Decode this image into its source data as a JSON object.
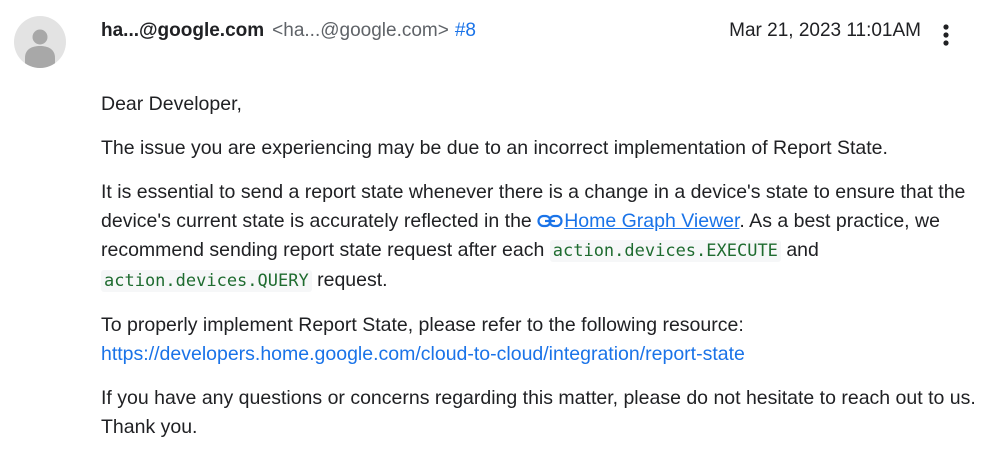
{
  "comment": {
    "sender_name": "ha...@google.com",
    "sender_email": "<ha...@google.com>",
    "comment_number": "#8",
    "date": "Mar 21, 2023 11:01AM",
    "avatar_icon": "person-icon",
    "menu_icon": "more-vert-icon"
  },
  "body": {
    "greeting": "Dear Developer,",
    "para1": "The issue you are experiencing may be due to an incorrect implementation of Report State.",
    "para2": {
      "text1": "It is essential to send a report state whenever there is a change in a device's state to ensure that the device's current state is accurately reflected in the ",
      "link_icon": "link-icon",
      "link_text": "Home Graph Viewer",
      "text2": ". As a best practice, we recommend sending report state request after each ",
      "code1": "action.devices.EXECUTE",
      "text3": " and ",
      "code2": "action.devices.QUERY",
      "text4": " request."
    },
    "para3": {
      "text": "To properly implement Report State, please refer to the following resource:",
      "url": "https://developers.home.google.com/cloud-to-cloud/integration/report-state"
    },
    "para4": "If you have any questions or concerns regarding this matter, please do not hesitate to reach out to us. Thank you."
  },
  "colors": {
    "link": "#1a73e8",
    "code_text": "#1e6b2f",
    "code_bg": "#f6f7f8",
    "muted": "#5f6368",
    "avatar_bg": "#e3e3e3"
  }
}
